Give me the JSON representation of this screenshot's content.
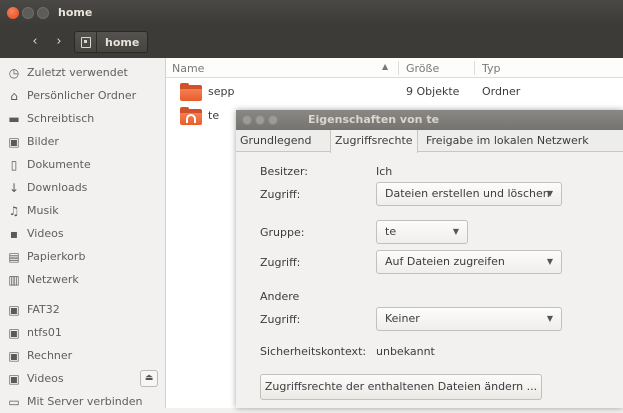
{
  "window": {
    "title": "home"
  },
  "toolbar": {
    "back_icon": "chevron-left-icon",
    "forward_icon": "chevron-right-icon",
    "breadcrumb_label": "home"
  },
  "sidebar": {
    "items": [
      {
        "label": "Zuletzt verwendet",
        "icon": "clock-icon"
      },
      {
        "label": "Persönlicher Ordner",
        "icon": "home-icon"
      },
      {
        "label": "Schreibtisch",
        "icon": "desktop-folder-icon"
      },
      {
        "label": "Bilder",
        "icon": "camera-icon"
      },
      {
        "label": "Dokumente",
        "icon": "document-icon"
      },
      {
        "label": "Downloads",
        "icon": "download-arrow-icon"
      },
      {
        "label": "Musik",
        "icon": "music-note-icon"
      },
      {
        "label": "Videos",
        "icon": "film-icon"
      },
      {
        "label": "Papierkorb",
        "icon": "trash-icon"
      },
      {
        "label": "Netzwerk",
        "icon": "network-icon"
      },
      {
        "label": "FAT32",
        "icon": "drive-icon"
      },
      {
        "label": "ntfs01",
        "icon": "drive-icon"
      },
      {
        "label": "Rechner",
        "icon": "drive-icon"
      },
      {
        "label": "Videos",
        "icon": "drive-icon",
        "eject": true
      },
      {
        "label": "Mit Server verbinden",
        "icon": "server-icon"
      }
    ]
  },
  "list": {
    "columns": {
      "name": "Name",
      "size": "Größe",
      "type": "Typ"
    },
    "rows": [
      {
        "name": "sepp",
        "size": "9 Objekte",
        "type": "Ordner"
      },
      {
        "name": "te",
        "size": "",
        "type": ""
      }
    ]
  },
  "dialog": {
    "title": "Eigenschaften von te",
    "tabs": [
      "Grundlegend",
      "Zugriffsrechte",
      "Freigabe im lokalen Netzwerk"
    ],
    "active_tab": "Zugriffsrechte",
    "owner_label": "Besitzer:",
    "owner_value": "Ich",
    "owner_access_label": "Zugriff:",
    "owner_access_value": "Dateien erstellen und löschen",
    "group_label": "Gruppe:",
    "group_value": "te",
    "group_access_label": "Zugriff:",
    "group_access_value": "Auf Dateien zugreifen",
    "others_label": "Andere",
    "others_access_label": "Zugriff:",
    "others_access_value": "Keiner",
    "security_context_label": "Sicherheitskontext:",
    "security_context_value": "unbekannt",
    "change_button": "Zugriffsrechte der enthaltenen Dateien ändern ..."
  },
  "colors": {
    "titlebar": "#3c3b37",
    "folder": "#e95d2c",
    "close_button": "#e0481a"
  }
}
